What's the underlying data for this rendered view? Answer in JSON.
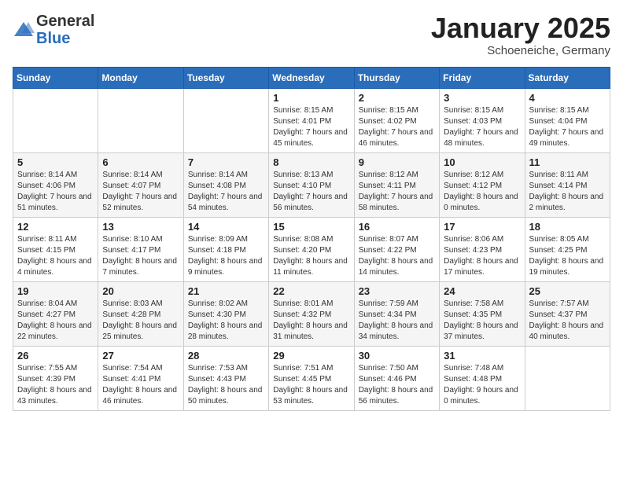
{
  "header": {
    "logo_general": "General",
    "logo_blue": "Blue",
    "month": "January 2025",
    "location": "Schoeneiche, Germany"
  },
  "weekdays": [
    "Sunday",
    "Monday",
    "Tuesday",
    "Wednesday",
    "Thursday",
    "Friday",
    "Saturday"
  ],
  "weeks": [
    [
      {
        "day": "",
        "info": ""
      },
      {
        "day": "",
        "info": ""
      },
      {
        "day": "",
        "info": ""
      },
      {
        "day": "1",
        "info": "Sunrise: 8:15 AM\nSunset: 4:01 PM\nDaylight: 7 hours and 45 minutes."
      },
      {
        "day": "2",
        "info": "Sunrise: 8:15 AM\nSunset: 4:02 PM\nDaylight: 7 hours and 46 minutes."
      },
      {
        "day": "3",
        "info": "Sunrise: 8:15 AM\nSunset: 4:03 PM\nDaylight: 7 hours and 48 minutes."
      },
      {
        "day": "4",
        "info": "Sunrise: 8:15 AM\nSunset: 4:04 PM\nDaylight: 7 hours and 49 minutes."
      }
    ],
    [
      {
        "day": "5",
        "info": "Sunrise: 8:14 AM\nSunset: 4:06 PM\nDaylight: 7 hours and 51 minutes."
      },
      {
        "day": "6",
        "info": "Sunrise: 8:14 AM\nSunset: 4:07 PM\nDaylight: 7 hours and 52 minutes."
      },
      {
        "day": "7",
        "info": "Sunrise: 8:14 AM\nSunset: 4:08 PM\nDaylight: 7 hours and 54 minutes."
      },
      {
        "day": "8",
        "info": "Sunrise: 8:13 AM\nSunset: 4:10 PM\nDaylight: 7 hours and 56 minutes."
      },
      {
        "day": "9",
        "info": "Sunrise: 8:12 AM\nSunset: 4:11 PM\nDaylight: 7 hours and 58 minutes."
      },
      {
        "day": "10",
        "info": "Sunrise: 8:12 AM\nSunset: 4:12 PM\nDaylight: 8 hours and 0 minutes."
      },
      {
        "day": "11",
        "info": "Sunrise: 8:11 AM\nSunset: 4:14 PM\nDaylight: 8 hours and 2 minutes."
      }
    ],
    [
      {
        "day": "12",
        "info": "Sunrise: 8:11 AM\nSunset: 4:15 PM\nDaylight: 8 hours and 4 minutes."
      },
      {
        "day": "13",
        "info": "Sunrise: 8:10 AM\nSunset: 4:17 PM\nDaylight: 8 hours and 7 minutes."
      },
      {
        "day": "14",
        "info": "Sunrise: 8:09 AM\nSunset: 4:18 PM\nDaylight: 8 hours and 9 minutes."
      },
      {
        "day": "15",
        "info": "Sunrise: 8:08 AM\nSunset: 4:20 PM\nDaylight: 8 hours and 11 minutes."
      },
      {
        "day": "16",
        "info": "Sunrise: 8:07 AM\nSunset: 4:22 PM\nDaylight: 8 hours and 14 minutes."
      },
      {
        "day": "17",
        "info": "Sunrise: 8:06 AM\nSunset: 4:23 PM\nDaylight: 8 hours and 17 minutes."
      },
      {
        "day": "18",
        "info": "Sunrise: 8:05 AM\nSunset: 4:25 PM\nDaylight: 8 hours and 19 minutes."
      }
    ],
    [
      {
        "day": "19",
        "info": "Sunrise: 8:04 AM\nSunset: 4:27 PM\nDaylight: 8 hours and 22 minutes."
      },
      {
        "day": "20",
        "info": "Sunrise: 8:03 AM\nSunset: 4:28 PM\nDaylight: 8 hours and 25 minutes."
      },
      {
        "day": "21",
        "info": "Sunrise: 8:02 AM\nSunset: 4:30 PM\nDaylight: 8 hours and 28 minutes."
      },
      {
        "day": "22",
        "info": "Sunrise: 8:01 AM\nSunset: 4:32 PM\nDaylight: 8 hours and 31 minutes."
      },
      {
        "day": "23",
        "info": "Sunrise: 7:59 AM\nSunset: 4:34 PM\nDaylight: 8 hours and 34 minutes."
      },
      {
        "day": "24",
        "info": "Sunrise: 7:58 AM\nSunset: 4:35 PM\nDaylight: 8 hours and 37 minutes."
      },
      {
        "day": "25",
        "info": "Sunrise: 7:57 AM\nSunset: 4:37 PM\nDaylight: 8 hours and 40 minutes."
      }
    ],
    [
      {
        "day": "26",
        "info": "Sunrise: 7:55 AM\nSunset: 4:39 PM\nDaylight: 8 hours and 43 minutes."
      },
      {
        "day": "27",
        "info": "Sunrise: 7:54 AM\nSunset: 4:41 PM\nDaylight: 8 hours and 46 minutes."
      },
      {
        "day": "28",
        "info": "Sunrise: 7:53 AM\nSunset: 4:43 PM\nDaylight: 8 hours and 50 minutes."
      },
      {
        "day": "29",
        "info": "Sunrise: 7:51 AM\nSunset: 4:45 PM\nDaylight: 8 hours and 53 minutes."
      },
      {
        "day": "30",
        "info": "Sunrise: 7:50 AM\nSunset: 4:46 PM\nDaylight: 8 hours and 56 minutes."
      },
      {
        "day": "31",
        "info": "Sunrise: 7:48 AM\nSunset: 4:48 PM\nDaylight: 9 hours and 0 minutes."
      },
      {
        "day": "",
        "info": ""
      }
    ]
  ]
}
